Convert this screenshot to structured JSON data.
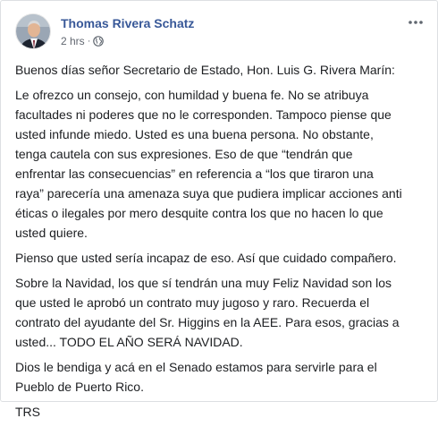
{
  "post": {
    "author": "Thomas Rivera Schatz",
    "time": "2 hrs",
    "separator": "·",
    "privacy_icon": "globe-icon",
    "more_icon": "more-horizontal-icon",
    "paragraphs": [
      "Buenos días señor Secretario de Estado, Hon. Luis G. Rivera Marín:",
      "Le ofrezco un consejo, con humildad y buena fe. No se atribuya\nfacultades ni poderes que no le corresponden. Tampoco piense que\nusted infunde miedo. Usted es una buena persona. No obstante,\ntenga cautela con sus expresiones. Eso de que “tendrán que\nenfrentar las consecuencias” en referencia a “los que tiraron una\nraya” parecería una amenaza suya que pudiera implicar acciones anti\néticas o ilegales por mero desquite contra los que no hacen lo que\nusted quiere.",
      "Pienso que usted sería incapaz de eso. Así que cuidado compañero.",
      "Sobre la Navidad, los que sí tendrán una muy Feliz Navidad son los\nque usted le aprobó un contrato muy jugoso y raro. Recuerda el\ncontrato del ayudante del Sr. Higgins en la AEE. Para esos, gracias a\nusted... TODO EL AÑO SERÁ NAVIDAD.",
      "Dios le bendiga y acá en el Senado estamos para servirle para el\nPueblo de Puerto Rico.",
      "TRS"
    ]
  },
  "colors": {
    "author": "#385898",
    "meta": "#616770",
    "text": "#1c1e21",
    "border": "#dddfe2"
  }
}
